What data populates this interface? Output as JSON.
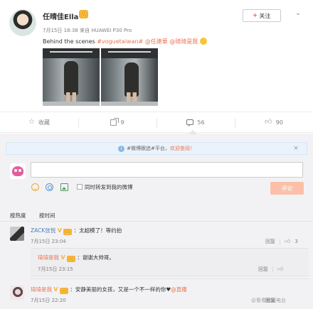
{
  "post": {
    "author": "任晴佳Ella",
    "crown": "👑",
    "date": "7月15日 18:38",
    "source_prefix": "来自",
    "source": "HUAWEI P30 Pro",
    "text_lead": "Behind the scenes ",
    "tag": "#voguetaiwan#",
    "mention1": "@任建華",
    "mention2": "@琦琦是我"
  },
  "follow": {
    "plus": "+",
    "label": "关注"
  },
  "more": "⌄",
  "actions": {
    "favorite": "收藏",
    "repost": "9",
    "comment": "56",
    "like": "90"
  },
  "notice": {
    "icon": "i",
    "text_a": "#微博跟追#平台，",
    "text_b": "欢迎查阅！",
    "close": "×"
  },
  "composer": {
    "placeholder": "",
    "repost_label": "同时转发到我的微博",
    "submit_label": "评论"
  },
  "sort": {
    "hot": "按热度",
    "time": "按时间"
  },
  "comments": [
    {
      "user": "ZACK张悦",
      "badge": "V",
      "vip": "👑",
      "text": "：太超模了！等约拍",
      "time": "7月15日 23:04",
      "reply": "回复",
      "likes": "3"
    },
    {
      "user": "琦琦是我",
      "badge": "V",
      "vip": "👑",
      "text": "：谢谢大帅哥。",
      "time": "7月15日 23:15",
      "reply": "回复",
      "likes": ""
    },
    {
      "user": "琦琦是我",
      "badge": "V",
      "vip": "👑",
      "text": "：安静美丽的女孩，又是一个不一样的你♥",
      "emoji_text": "@直播",
      "time": "7月15日 22:20",
      "reply": "回复",
      "likes": ""
    }
  ],
  "watermark": "@看看新闻电台",
  "icons": {
    "favorite": "star-icon",
    "repost": "share-icon",
    "comment": "comment-icon",
    "like": "thumb-up-icon"
  },
  "colors": {
    "link": "#eb7350",
    "name_link": "#507daf",
    "submit_disabled": "#fcc0a8",
    "panel_bg": "#f2f2f5"
  }
}
